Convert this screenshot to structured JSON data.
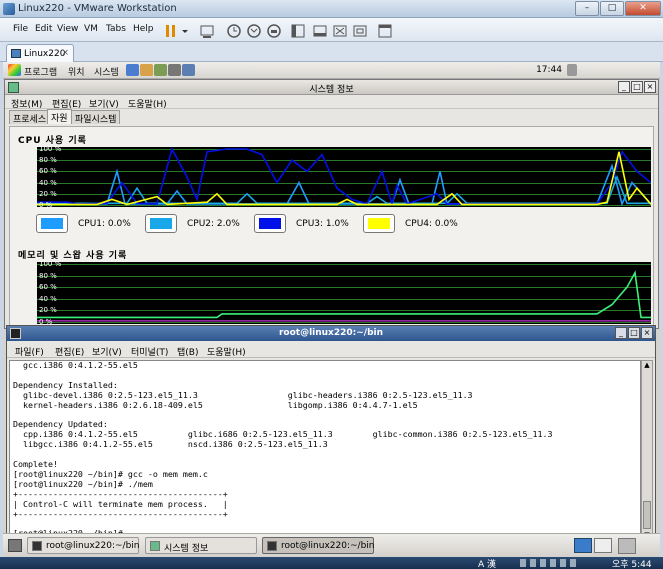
{
  "vmware": {
    "title": "Linux220 - VMware Workstation",
    "menu": [
      "File",
      "Edit",
      "View",
      "VM",
      "Tabs",
      "Help"
    ],
    "tab_label": "Linux220",
    "tab_close": "×"
  },
  "gnome_top": {
    "items": [
      "프로그램",
      "위치",
      "시스템"
    ],
    "clock": "17:44"
  },
  "sysmon": {
    "title": "시스템 정보",
    "menu": [
      "정보(M)",
      "편집(E)",
      "보기(V)",
      "도움말(H)"
    ],
    "tabs": [
      "프로세스",
      "자원",
      "파일시스템"
    ],
    "cpu_section": "CPU 사용 기록",
    "mem_section": "메모리 및 스왑 사용 기록",
    "ylabels": [
      "100 %",
      "80 %",
      "60 %",
      "40 %",
      "20 %",
      "0 %"
    ],
    "cpu_legend": [
      {
        "label": "CPU1:",
        "value": "0.0%",
        "color": "#1e9cff"
      },
      {
        "label": "CPU2:",
        "value": "2.0%",
        "color": "#18a7e8"
      },
      {
        "label": "CPU3:",
        "value": "1.0%",
        "color": "#0010e8"
      },
      {
        "label": "CPU4:",
        "value": "0.0%",
        "color": "#ffff00"
      }
    ]
  },
  "terminal": {
    "title": "root@linux220:~/bin",
    "menu": [
      "파일(F)",
      "편집(E)",
      "보기(V)",
      "터미널(T)",
      "탭(B)",
      "도움말(H)"
    ],
    "lines": [
      "  gcc.i386 0:4.1.2-55.el5",
      "",
      "Dependency Installed:",
      "  glibc-devel.i386 0:2.5-123.el5_11.3                  glibc-headers.i386 0:2.5-123.el5_11.3",
      "  kernel-headers.i386 0:2.6.18-409.el5                 libgomp.i386 0:4.4.7-1.el5",
      "",
      "Dependency Updated:",
      "  cpp.i386 0:4.1.2-55.el5          glibc.i686 0:2.5-123.el5_11.3        glibc-common.i386 0:2.5-123.el5_11.3",
      "  libgcc.i386 0:4.1.2-55.el5       nscd.i386 0:2.5-123.el5_11.3",
      "",
      "Complete!",
      "[root@linux220 ~/bin]# gcc -o mem mem.c",
      "[root@linux220 ~/bin]# ./mem",
      "+-----------------------------------------+",
      "| Control-C will terminate mem process.   |",
      "+-----------------------------------------+",
      "",
      "[root@linux220 ~/bin]#"
    ]
  },
  "gnome_bottom": {
    "tasks": [
      {
        "label": "root@linux220:~/bin",
        "active": false
      },
      {
        "label": "시스템 정보",
        "active": false
      },
      {
        "label": "root@linux220:~/bin",
        "active": true
      }
    ]
  },
  "windows_tray": {
    "ime": "A 漢",
    "time": "오후 5:44"
  }
}
